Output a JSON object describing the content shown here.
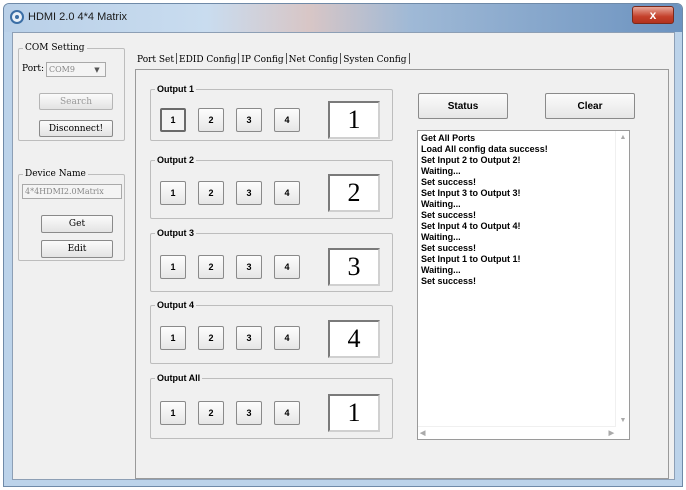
{
  "window": {
    "title": "HDMI 2.0 4*4 Matrix",
    "close_glyph": "x"
  },
  "com_setting": {
    "legend": "COM Setting",
    "port_label": "Port:",
    "port_value": "COM9",
    "search_label": "Search",
    "disconnect_label": "Disconnect!"
  },
  "device_name": {
    "legend": "Device Name",
    "value": "4*4HDMI2.0Matrix",
    "get_label": "Get",
    "edit_label": "Edit"
  },
  "tabs": [
    "Port Set",
    "EDID Config",
    "IP Config",
    "Net Config",
    "Systen Config"
  ],
  "outputs": [
    {
      "legend": "Output 1",
      "buttons": [
        "1",
        "2",
        "3",
        "4"
      ],
      "selected": "1",
      "display": "1"
    },
    {
      "legend": "Output 2",
      "buttons": [
        "1",
        "2",
        "3",
        "4"
      ],
      "selected": "",
      "display": "2"
    },
    {
      "legend": "Output 3",
      "buttons": [
        "1",
        "2",
        "3",
        "4"
      ],
      "selected": "",
      "display": "3"
    },
    {
      "legend": "Output 4",
      "buttons": [
        "1",
        "2",
        "3",
        "4"
      ],
      "selected": "",
      "display": "4"
    },
    {
      "legend": "Output All",
      "buttons": [
        "1",
        "2",
        "3",
        "4"
      ],
      "selected": "",
      "display": "1"
    }
  ],
  "status_label": "Status",
  "clear_label": "Clear",
  "log": [
    "Get All Ports",
    "Load All config data success!",
    "Set Input 2 to Output 2!",
    "Waiting...",
    "Set success!",
    "Set Input 3 to Output 3!",
    "Waiting...",
    "Set success!",
    "Set Input 4 to Output 4!",
    "Waiting...",
    "Set success!",
    "Set Input 1 to Output 1!",
    "Waiting...",
    "Set success!"
  ],
  "icons": {
    "app": "app-icon",
    "close": "close-icon",
    "combo": "chevron-down-icon",
    "scroll_up": "scroll-up-icon",
    "scroll_down": "scroll-down-icon",
    "scroll_left": "scroll-left-icon",
    "scroll_right": "scroll-right-icon"
  }
}
